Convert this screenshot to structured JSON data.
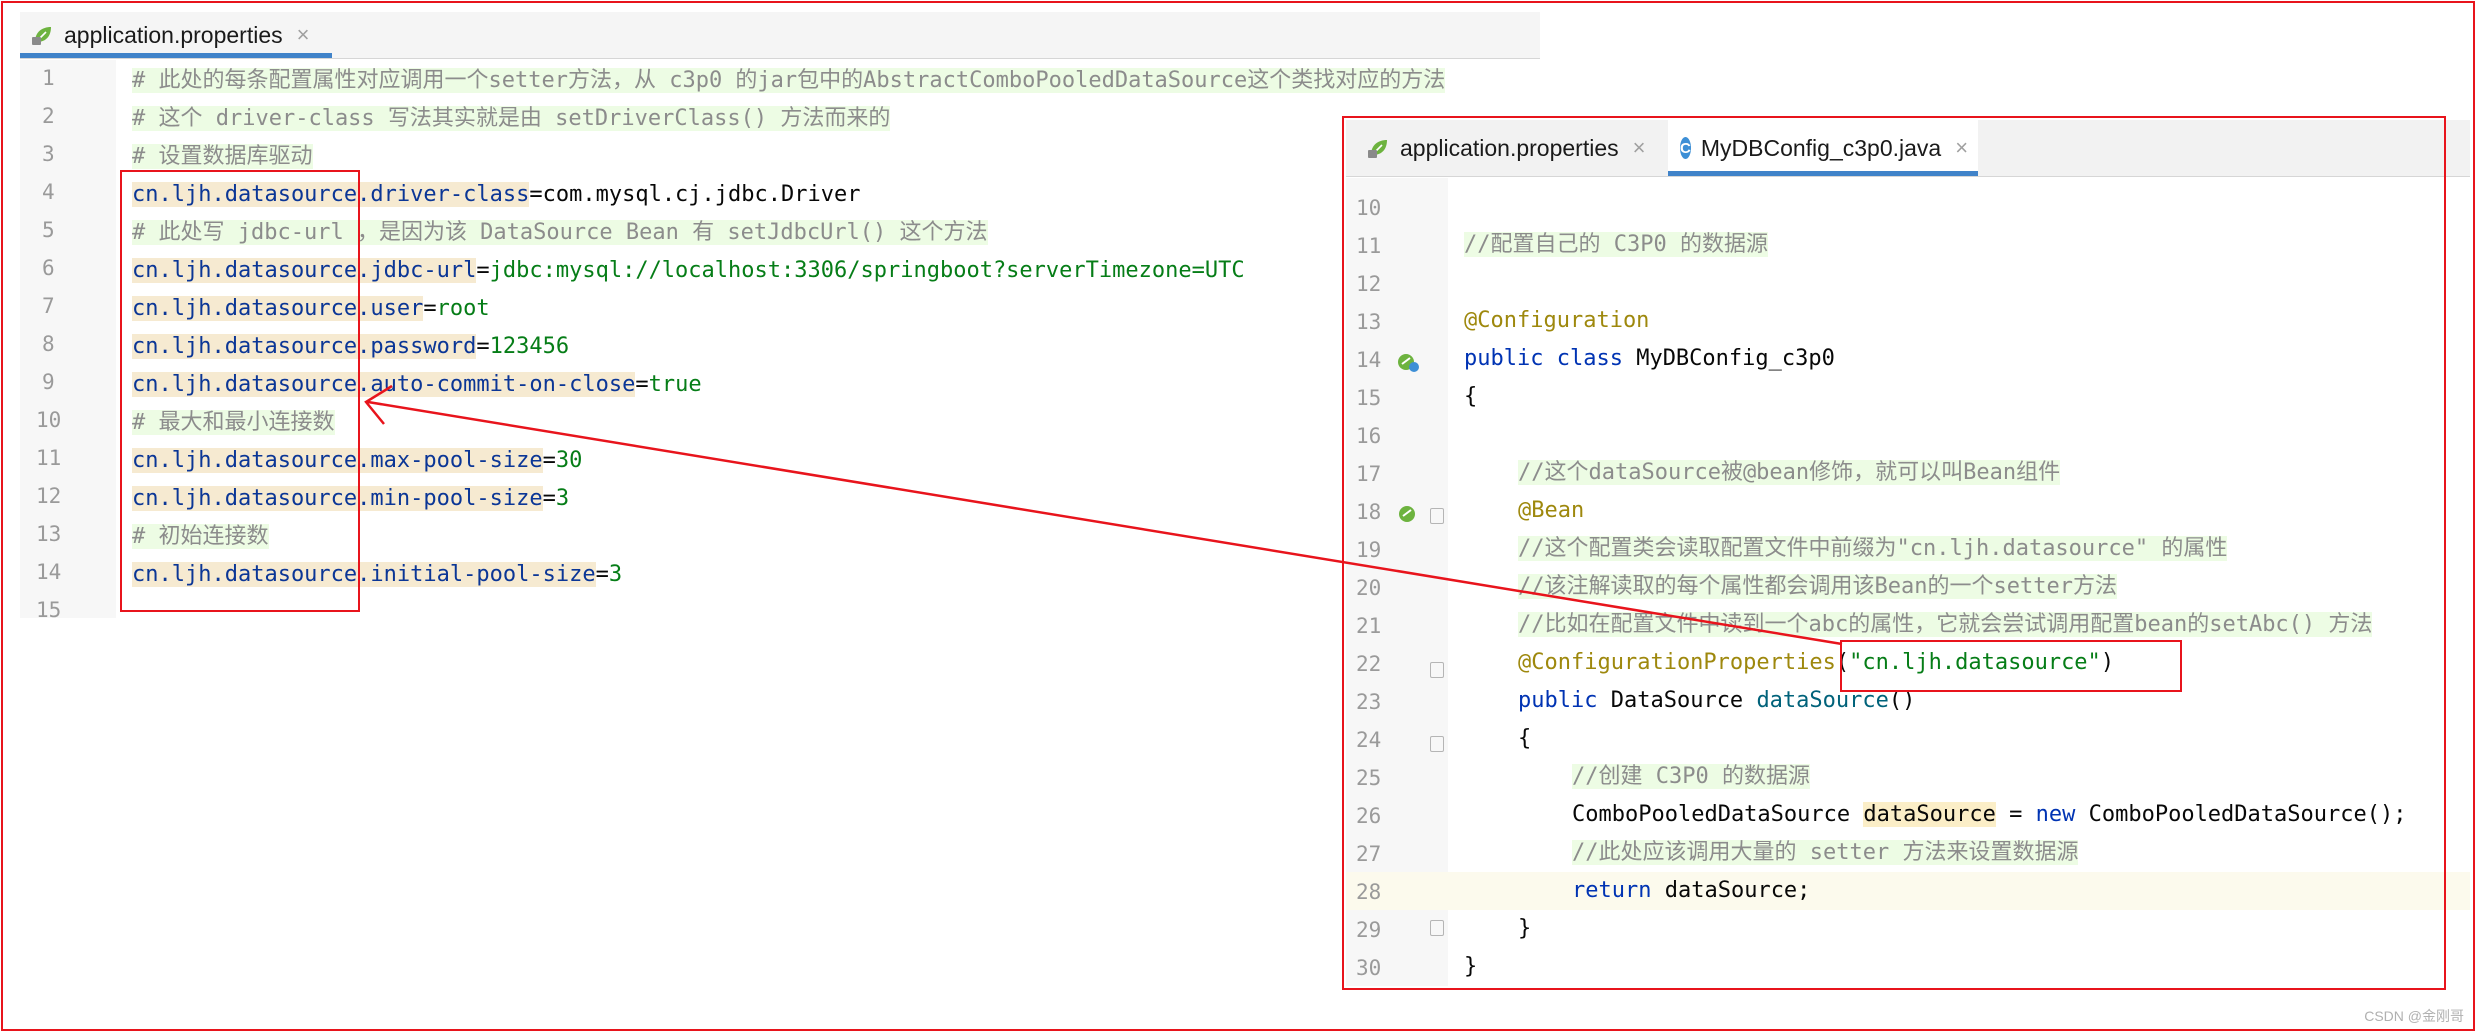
{
  "left_editor": {
    "tab": {
      "label": "application.properties",
      "close": "×"
    },
    "lines": [
      {
        "n": "1"
      },
      {
        "n": "2"
      },
      {
        "n": "3"
      },
      {
        "n": "4"
      },
      {
        "n": "5"
      },
      {
        "n": "6"
      },
      {
        "n": "7"
      },
      {
        "n": "8"
      },
      {
        "n": "9"
      },
      {
        "n": "10"
      },
      {
        "n": "11"
      },
      {
        "n": "12"
      },
      {
        "n": "13"
      },
      {
        "n": "14"
      },
      {
        "n": "15"
      }
    ],
    "code": {
      "l1": "# 此处的每条配置属性对应调用一个setter方法，从 c3p0 的jar包中的AbstractComboPooledDataSource这个类找对应的方法",
      "l2": "# 这个 driver-class 写法其实就是由 setDriverClass() 方法而来的",
      "l3": "# 设置数据库驱动",
      "l4_key": "cn.ljh.datasource.driver-class",
      "l4_val": "com.mysql.cj.jdbc.Driver",
      "l5": "# 此处写 jdbc-url ，是因为该 DataSource Bean 有 setJdbcUrl() 这个方法",
      "l6_key": "cn.ljh.datasource.jdbc-url",
      "l6_val": "jdbc:mysql://localhost:3306/springboot?serverTimezone=UTC",
      "l7_key": "cn.ljh.datasource.user",
      "l7_val": "root",
      "l8_key": "cn.ljh.datasource.password",
      "l8_val": "123456",
      "l9_key": "cn.ljh.datasource.auto-commit-on-close",
      "l9_val": "true",
      "l10": "# 最大和最小连接数",
      "l11_key": "cn.ljh.datasource.max-pool-size",
      "l11_val": "30",
      "l12_key": "cn.ljh.datasource.min-pool-size",
      "l12_val": "3",
      "l13": "# 初始连接数",
      "l14_key": "cn.ljh.datasource.initial-pool-size",
      "l14_val": "3",
      "eq": "="
    }
  },
  "right_editor": {
    "tabs": [
      {
        "label": "application.properties",
        "close": "×"
      },
      {
        "label": "MyDBConfig_c3p0.java",
        "close": "×",
        "icon_letter": "C"
      }
    ],
    "lines": [
      {
        "n": "10"
      },
      {
        "n": "11"
      },
      {
        "n": "12"
      },
      {
        "n": "13"
      },
      {
        "n": "14"
      },
      {
        "n": "15"
      },
      {
        "n": "16"
      },
      {
        "n": "17"
      },
      {
        "n": "18"
      },
      {
        "n": "19"
      },
      {
        "n": "20"
      },
      {
        "n": "21"
      },
      {
        "n": "22"
      },
      {
        "n": "23"
      },
      {
        "n": "24"
      },
      {
        "n": "25"
      },
      {
        "n": "26"
      },
      {
        "n": "27"
      },
      {
        "n": "28"
      },
      {
        "n": "29"
      },
      {
        "n": "30"
      }
    ],
    "code": {
      "l11": "//配置自己的 C3P0 的数据源",
      "l13": "@Configuration",
      "l14_kw": "public class",
      "l14_name": " MyDBConfig_c3p0",
      "l15": "{",
      "l17": "//这个dataSource被@bean修饰，就可以叫Bean组件",
      "l18": "@Bean",
      "l19": "//这个配置类会读取配置文件中前缀为\"cn.ljh.datasource\" 的属性",
      "l20": "//该注解读取的每个属性都会调用该Bean的一个setter方法",
      "l21": "//比如在配置文件中读到一个abc的属性，它就会尝试调用配置bean的setAbc() 方法",
      "l22_ann": "@ConfigurationProperties",
      "l22_open": "(",
      "l22_str": "\"cn.ljh.datasource\"",
      "l22_close": ")",
      "l23_kw": "public",
      "l23_type": " DataSource ",
      "l23_mth": "dataSource",
      "l23_paren": "()",
      "l24": "{",
      "l25": "//创建 C3P0 的数据源",
      "l26_a": "ComboPooledDataSource ",
      "l26_var": "dataSource",
      "l26_b": " = ",
      "l26_kw": "new",
      "l26_c": " ComboPooledDataSource();",
      "l27": "//此处应该调用大量的 setter 方法来设置数据源",
      "l28_kw": "return",
      "l28_rest": " dataSource;",
      "l29": "}",
      "l30": "}"
    }
  },
  "watermark": "CSDN @金刚哥",
  "colors": {
    "highlight_red": "#e8141c",
    "tab_accent": "#4083c9"
  }
}
